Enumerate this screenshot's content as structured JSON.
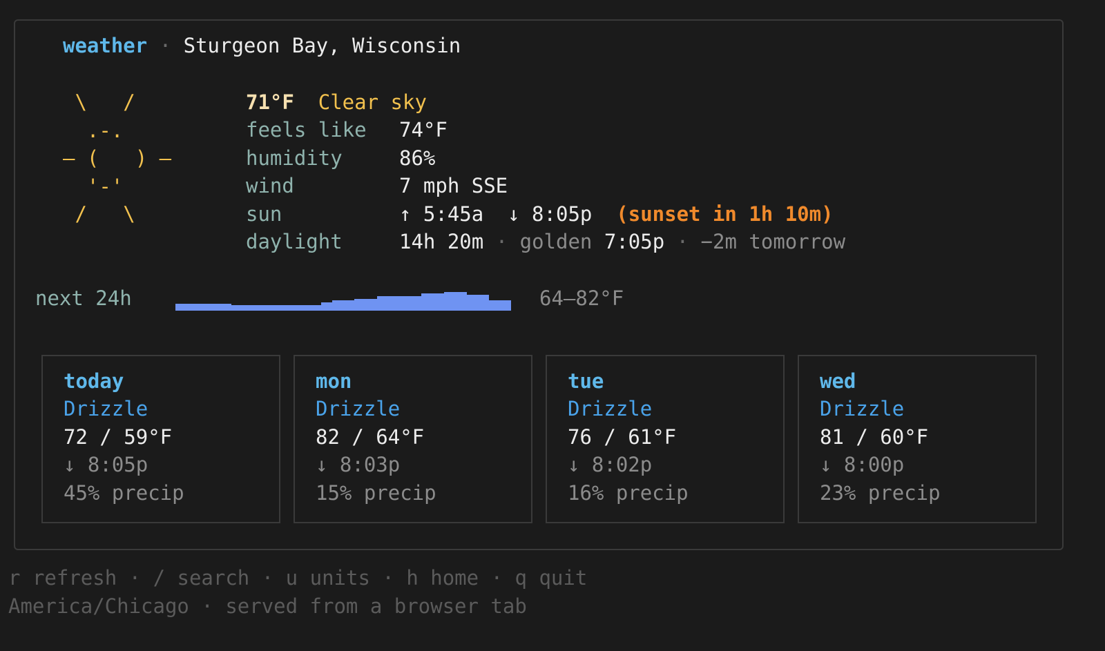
{
  "header": {
    "app": "weather",
    "separator": "·",
    "location": "Sturgeon Bay, Wisconsin"
  },
  "icon": {
    "name": "sun-icon",
    "art": " \\   /\n  .-.\n― (   ) ―\n  '-'\n /   \\"
  },
  "current": {
    "temp": "71°F",
    "condition": "Clear sky",
    "rows": [
      {
        "label": "feels like",
        "value": "74°F"
      },
      {
        "label": "humidity",
        "value": "86%"
      },
      {
        "label": "wind",
        "value": "7 mph SSE"
      }
    ],
    "sun": {
      "label": "sun",
      "rise": "↑ 5:45a",
      "set": "↓ 8:05p",
      "note": "(sunset in 1h 10m)"
    },
    "daylight": {
      "label": "daylight",
      "length": "14h 20m",
      "sep1": "·",
      "golden_label": "golden",
      "golden_time": "7:05p",
      "sep2": "·",
      "change": "−2m tomorrow"
    }
  },
  "next24": {
    "label": "next 24h",
    "range": "64–82°F",
    "unit": "°F",
    "min": 64,
    "max": 82,
    "color": "#6f93f2",
    "temps": [
      66,
      66,
      66,
      66,
      66,
      65,
      65,
      65,
      65,
      65,
      65,
      65,
      65,
      67,
      69,
      69,
      70,
      70,
      72,
      72,
      72,
      72,
      74,
      74,
      75,
      75,
      73,
      73,
      69,
      69
    ]
  },
  "forecast": [
    {
      "day": "today",
      "condition": "Drizzle",
      "temps": "72 / 59°F",
      "sunset": "↓ 8:05p",
      "precip": "45% precip"
    },
    {
      "day": "mon",
      "condition": "Drizzle",
      "temps": "82 / 64°F",
      "sunset": "↓ 8:03p",
      "precip": "15% precip"
    },
    {
      "day": "tue",
      "condition": "Drizzle",
      "temps": "76 / 61°F",
      "sunset": "↓ 8:02p",
      "precip": "16% precip"
    },
    {
      "day": "wed",
      "condition": "Drizzle",
      "temps": "81 / 60°F",
      "sunset": "↓ 8:00p",
      "precip": "23% precip"
    }
  ],
  "footer": {
    "keys": [
      {
        "key": "r",
        "action": "refresh"
      },
      {
        "key": "/",
        "action": "search"
      },
      {
        "key": "u",
        "action": "units"
      },
      {
        "key": "h",
        "action": "home"
      },
      {
        "key": "q",
        "action": "quit"
      }
    ],
    "separator": "·",
    "timezone": "America/Chicago",
    "source": "served from a browser tab"
  }
}
